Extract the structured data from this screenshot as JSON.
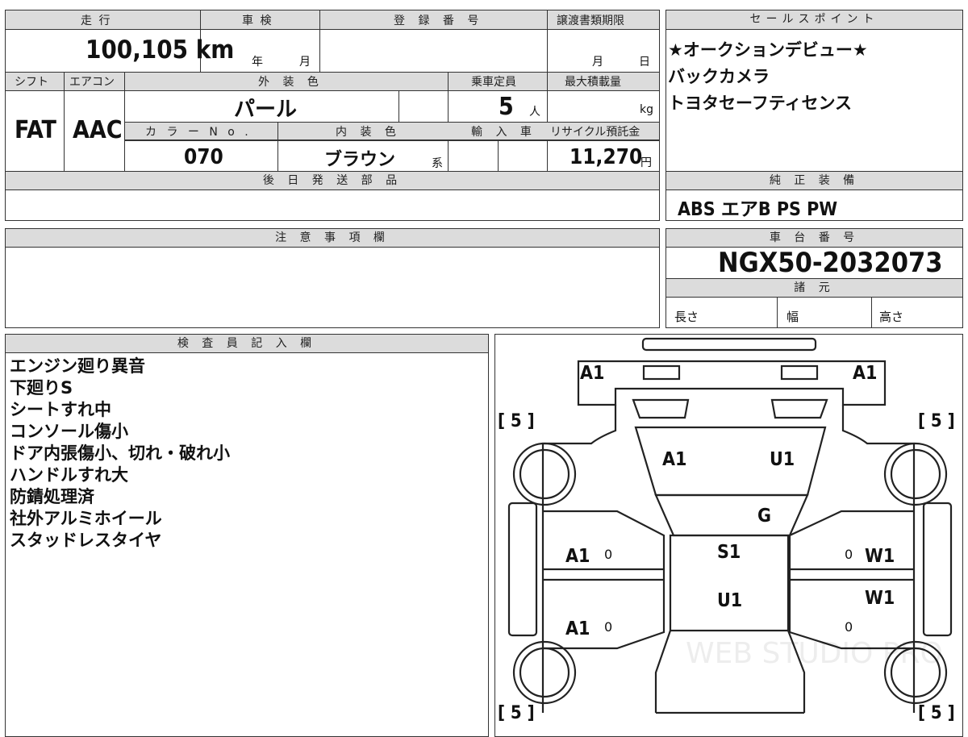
{
  "top": {
    "mileage_label": "走 行",
    "mileage_value": "100,105 km",
    "inspection_label": "車 検",
    "inspection_year_unit": "年",
    "inspection_month_unit": "月",
    "registration_label": "登 録 番 号",
    "registration_value": "",
    "transfer_label": "譲渡書類期限",
    "transfer_month_unit": "月",
    "transfer_day_unit": "日",
    "shift_label": "シフト",
    "shift_value": "FAT",
    "ac_label": "エアコン",
    "ac_value": "AAC",
    "exterior_label": "外 装 色",
    "exterior_value": "パール",
    "capacity_label": "乗車定員",
    "capacity_value": "5",
    "capacity_unit": "人",
    "max_load_label": "最大積載量",
    "max_load_unit": "kg",
    "color_no_label": "カ ラ ー N o .",
    "color_no_value": "070",
    "interior_label": "内 装 色",
    "interior_value": "ブラウン",
    "interior_suffix": "系",
    "import_label": "輸 入 車",
    "recycle_label": "リサイクル預託金",
    "recycle_value": "11,270",
    "recycle_unit": "円",
    "later_parts_label": "後 日 発 送 部 品"
  },
  "sales": {
    "label": "セールスポイント",
    "lines": [
      "★オークションデビュー★",
      "バックカメラ",
      "トヨタセーフティセンス"
    ]
  },
  "equipment": {
    "label": "純 正 装 備",
    "value": "ABS エアB PS PW"
  },
  "caution": {
    "label": "注 意 事 項 欄"
  },
  "chassis": {
    "label": "車 台 番 号",
    "value": "NGX50-2032073",
    "spec_label": "諸 元",
    "length_label": "長さ",
    "width_label": "幅",
    "height_label": "高さ"
  },
  "inspector": {
    "label": "検 査 員 記 入 欄",
    "notes": [
      "エンジン廻り異音",
      "下廻りS",
      "シートすれ中",
      "コンソール傷小",
      "ドア内張傷小、切れ・破れ小",
      "ハンドルすれ大",
      "防錆処理済",
      "社外アルミホイール",
      "スタッドレスタイヤ"
    ]
  },
  "diagram": {
    "marks": {
      "front_left": "A1",
      "front_right": "A1",
      "hood_left": "A1",
      "hood_right": "U1",
      "windshield": "G",
      "roof_1": "S1",
      "roof_2": "U1",
      "left_front_door": "A1",
      "left_rear_door": "A1",
      "right_front_door": "W1",
      "right_rear_door": "W1",
      "small_l1": "0",
      "small_l2": "0",
      "small_r1": "0",
      "small_r2": "0"
    },
    "tire_tl": "[ 5 ]",
    "tire_tr": "[ 5 ]",
    "tire_bl": "[ 5 ]",
    "tire_br": "[ 5 ]",
    "watermark": "WEB STUDIO PRO"
  }
}
